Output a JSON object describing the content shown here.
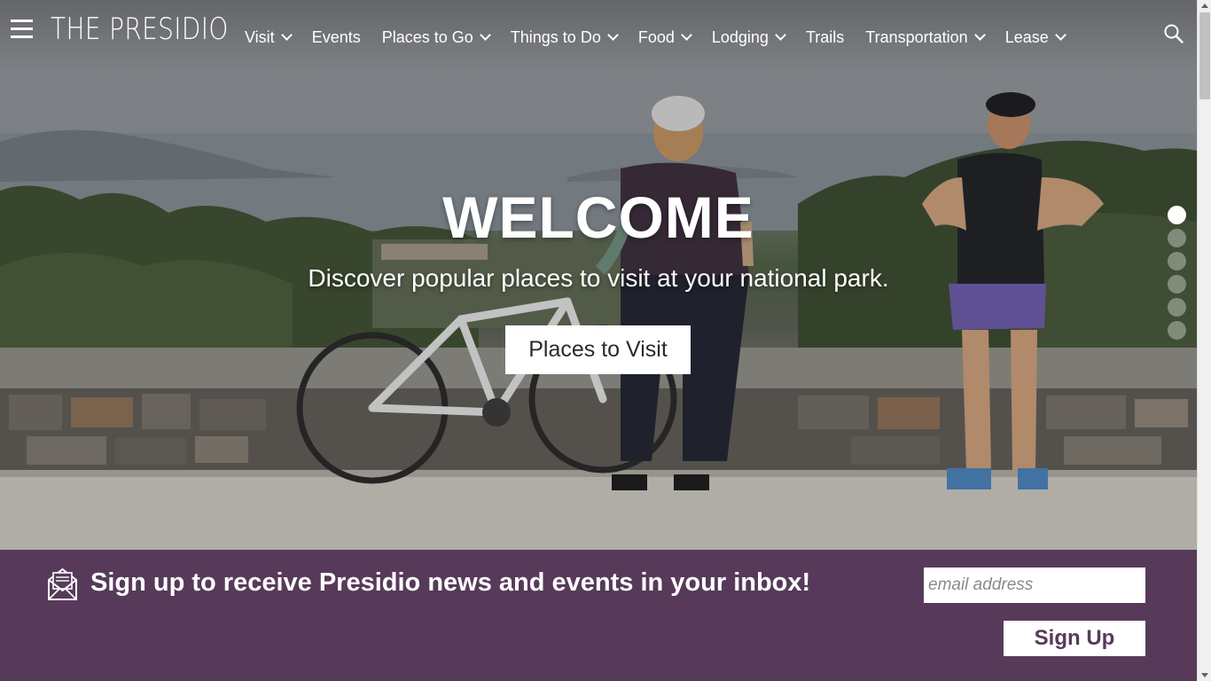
{
  "header": {
    "logo": "THE PRESIDIO",
    "nav": [
      {
        "label": "Visit",
        "has_dropdown": true
      },
      {
        "label": "Events",
        "has_dropdown": false
      },
      {
        "label": "Places to Go",
        "has_dropdown": true
      },
      {
        "label": "Things to Do",
        "has_dropdown": true
      },
      {
        "label": "Food",
        "has_dropdown": true
      },
      {
        "label": "Lodging",
        "has_dropdown": true
      },
      {
        "label": "Trails",
        "has_dropdown": false
      },
      {
        "label": "Transportation",
        "has_dropdown": true
      },
      {
        "label": "Lease",
        "has_dropdown": true
      }
    ],
    "icons": {
      "menu": "hamburger-menu-icon",
      "search": "search-icon"
    }
  },
  "hero": {
    "title": "WELCOME",
    "subtitle": "Discover popular places to visit at your national park.",
    "cta_label": "Places to Visit",
    "slide_count": 6,
    "active_slide": 1
  },
  "signup": {
    "text": "Sign up to receive Presidio news and events in your inbox!",
    "email_placeholder": "email address",
    "button_label": "Sign Up",
    "icon": "envelope-icon"
  },
  "colors": {
    "signup_background": "#573a5a",
    "nav_text": "#ffffff",
    "button_background": "#ffffff"
  }
}
